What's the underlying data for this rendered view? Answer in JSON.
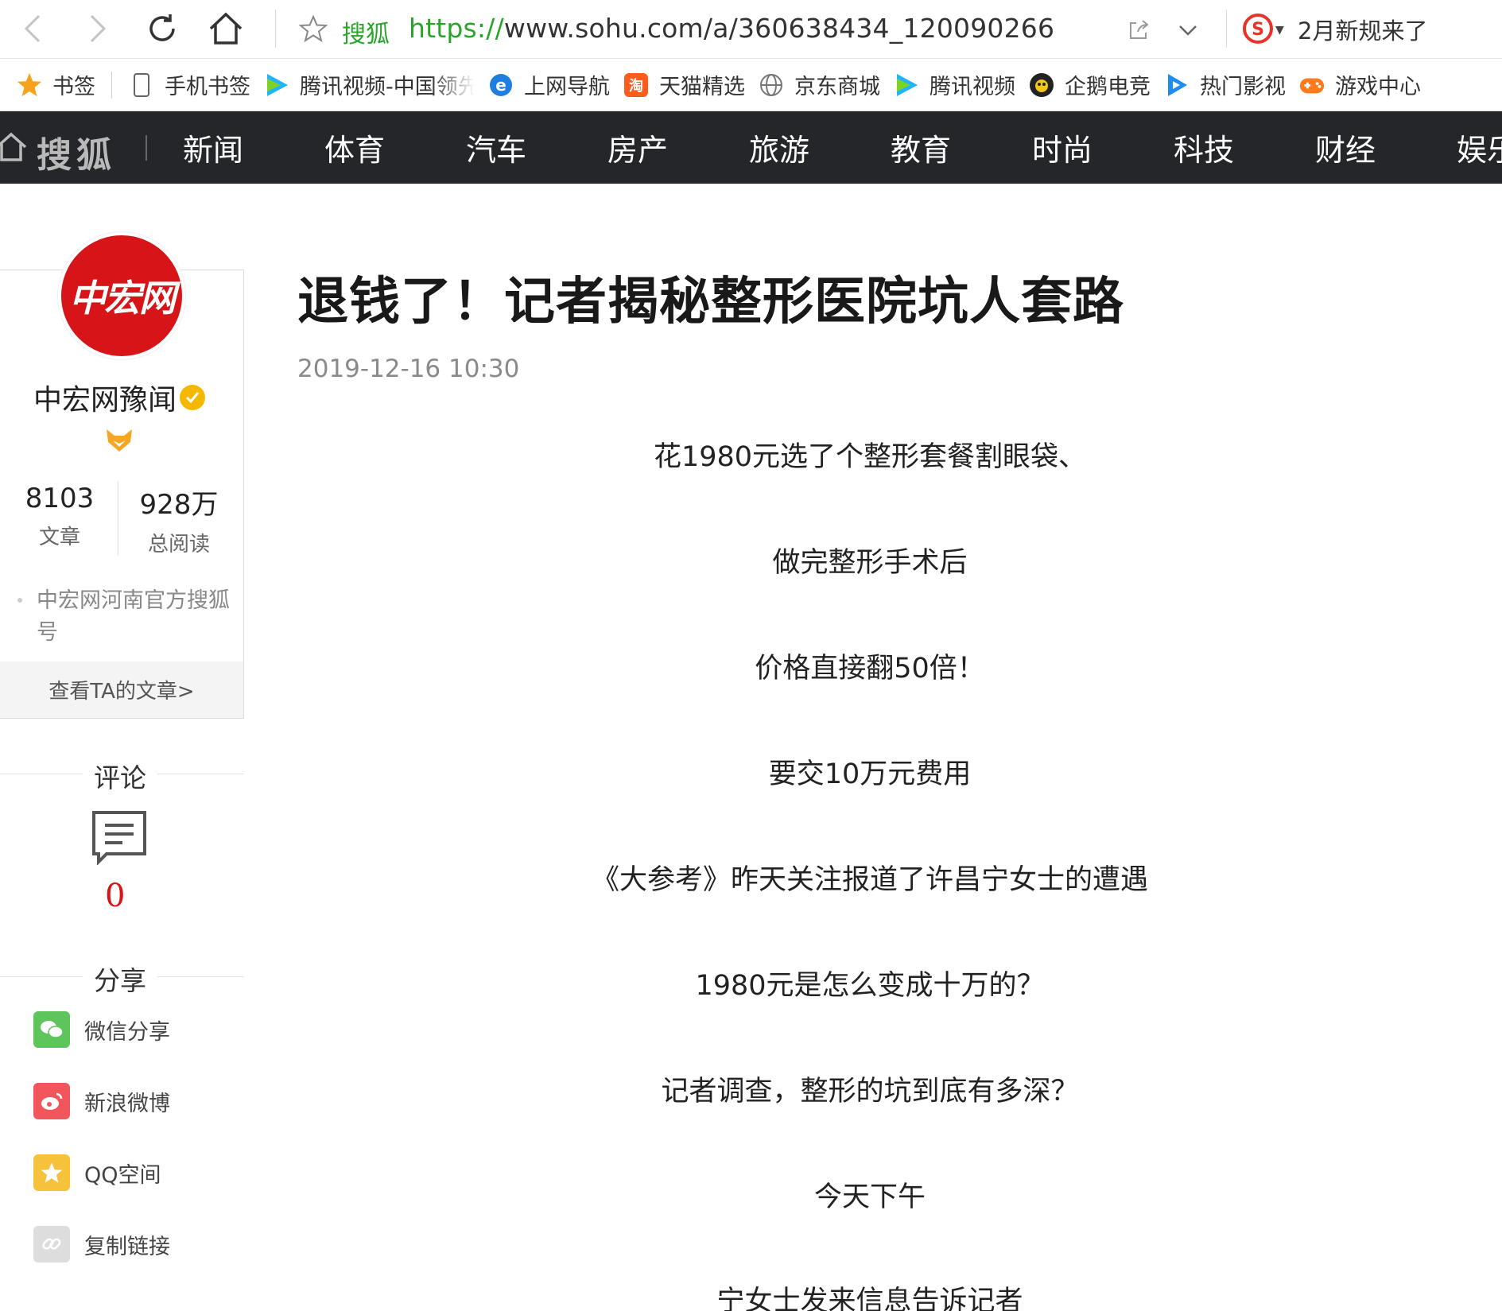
{
  "browser": {
    "site_name": "搜狐",
    "url_protocol": "https://",
    "url_rest": "www.sohu.com/a/360638434_120090266",
    "notice": "2月新规来了"
  },
  "bookmarks": [
    {
      "label": "书签",
      "icon": "star-icon"
    },
    {
      "label": "手机书签",
      "icon": "phone-icon"
    },
    {
      "label": "腾讯视频-中国领先",
      "icon": "tencent-video-icon"
    },
    {
      "label": "上网导航",
      "icon": "ie-icon"
    },
    {
      "label": "天猫精选",
      "icon": "tmall-icon"
    },
    {
      "label": "京东商城",
      "icon": "globe-icon"
    },
    {
      "label": "腾讯视频",
      "icon": "tencent-video-icon"
    },
    {
      "label": "企鹅电竞",
      "icon": "penguin-esports-icon"
    },
    {
      "label": "热门影视",
      "icon": "play-icon"
    },
    {
      "label": "游戏中心",
      "icon": "gamepad-icon"
    }
  ],
  "nav": {
    "logo": "搜狐",
    "items": [
      "新闻",
      "体育",
      "汽车",
      "房产",
      "旅游",
      "教育",
      "时尚",
      "科技",
      "财经",
      "娱乐"
    ]
  },
  "author": {
    "avatar_text": "中宏网",
    "name": "中宏网豫闻",
    "articles_count": "8103",
    "articles_label": "文章",
    "reads_count": "928万",
    "reads_label": "总阅读",
    "description": "中宏网河南官方搜狐号",
    "view_articles": "查看TA的文章>"
  },
  "comments": {
    "title": "评论",
    "count": "0"
  },
  "share": {
    "title": "分享",
    "items": [
      {
        "label": "微信分享",
        "icon": "wechat-icon",
        "color": "#5ec45c"
      },
      {
        "label": "新浪微博",
        "icon": "weibo-icon",
        "color": "#f0565b"
      },
      {
        "label": "QQ空间",
        "icon": "qzone-icon",
        "color": "#f7c23b"
      },
      {
        "label": "复制链接",
        "icon": "link-icon",
        "color": "#dddddd"
      }
    ]
  },
  "article": {
    "title": "退钱了！记者揭秘整形医院坑人套路",
    "date": "2019-12-16 10:30",
    "paragraphs": [
      "花1980元选了个整形套餐割眼袋、",
      "做完整形手术后",
      "价格直接翻50倍！",
      "要交10万元费用",
      "《大参考》昨天关注报道了许昌宁女士的遭遇",
      "1980元是怎么变成十万的？",
      "记者调查，整形的坑到底有多深？",
      "今天下午",
      "宁女士发来信息告诉记者"
    ]
  }
}
